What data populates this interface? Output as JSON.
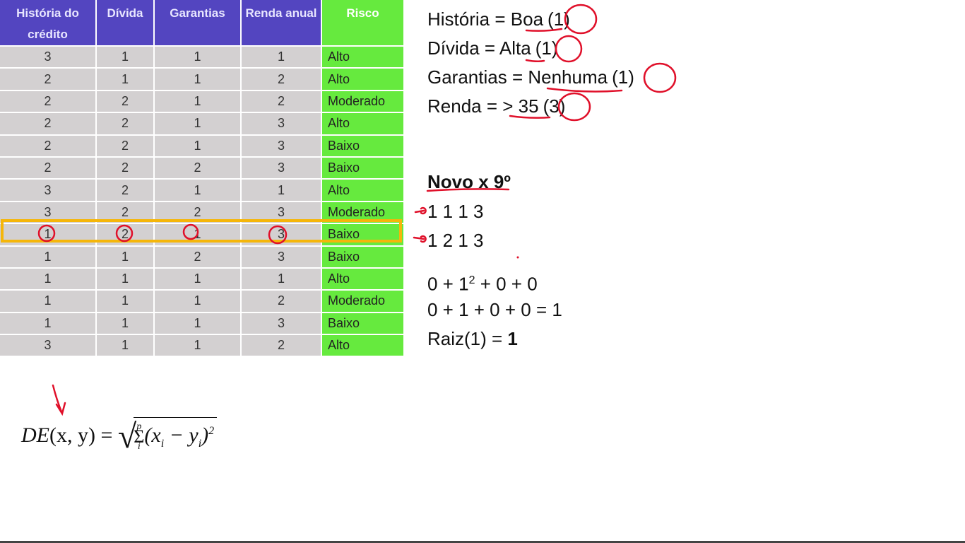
{
  "table": {
    "headers": [
      "História do crédito",
      "Dívida",
      "Garantias",
      "Renda anual",
      "Risco"
    ],
    "rows": [
      [
        "3",
        "1",
        "1",
        "1",
        "Alto"
      ],
      [
        "2",
        "1",
        "1",
        "2",
        "Alto"
      ],
      [
        "2",
        "2",
        "1",
        "2",
        "Moderado"
      ],
      [
        "2",
        "2",
        "1",
        "3",
        "Alto"
      ],
      [
        "2",
        "2",
        "1",
        "3",
        "Baixo"
      ],
      [
        "2",
        "2",
        "2",
        "3",
        "Baixo"
      ],
      [
        "3",
        "2",
        "1",
        "1",
        "Alto"
      ],
      [
        "3",
        "2",
        "2",
        "3",
        "Moderado"
      ],
      [
        "1",
        "2",
        "1",
        "3",
        "Baixo"
      ],
      [
        "1",
        "1",
        "2",
        "3",
        "Baixo"
      ],
      [
        "1",
        "1",
        "1",
        "1",
        "Alto"
      ],
      [
        "1",
        "1",
        "1",
        "2",
        "Moderado"
      ],
      [
        "1",
        "1",
        "1",
        "3",
        "Baixo"
      ],
      [
        "3",
        "1",
        "1",
        "2",
        "Alto"
      ]
    ],
    "highlight_color": "#f5b60a"
  },
  "attributes": [
    {
      "label": "História = ",
      "value": "Boa",
      "code": "(1)"
    },
    {
      "label": "Dívida = ",
      "value": "Alta",
      "code": "(1)"
    },
    {
      "label": "Garantias = ",
      "value": "Nenhuma",
      "code": "(1)"
    },
    {
      "label": "Renda = ",
      "value": "> 35",
      "code": "(3)"
    }
  ],
  "calc": {
    "title": "Novo x 9º",
    "vec1": "1 1 1 3",
    "vec2": "1 2 1 3",
    "step1_a": "0 + 1",
    "step1_sup": "2",
    "step1_b": " + 0 + 0",
    "step2": "0 + 1 + 0 + 0 = 1",
    "step3_a": "Raiz(1) = ",
    "step3_b": "1"
  },
  "formula": {
    "lhs": "DE",
    "args": "(x, y) =",
    "sum_top": "p",
    "sum_bottom": "i",
    "body": "(x",
    "sub1": "i",
    "minus": " − y",
    "sub2": "i",
    "close": ")",
    "exp": "2"
  }
}
